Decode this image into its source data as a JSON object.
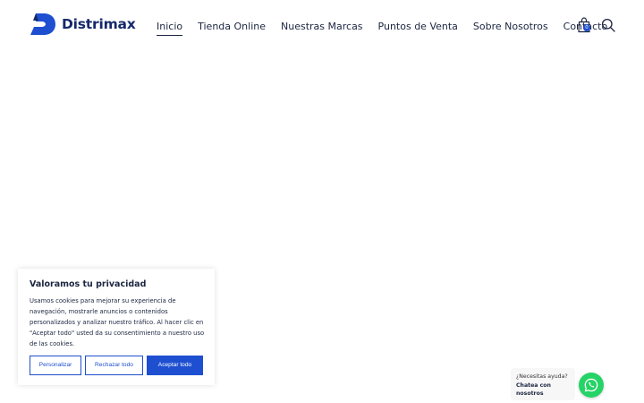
{
  "brand": {
    "name": "Distrimax",
    "color": "#15286a",
    "accent": "#1e4fd1"
  },
  "nav": {
    "items": [
      {
        "label": "Inicio",
        "active": true
      },
      {
        "label": "Tienda Online",
        "active": false
      },
      {
        "label": "Nuestras Marcas",
        "active": false
      },
      {
        "label": "Puntos de Venta",
        "active": false
      },
      {
        "label": "Sobre Nosotros",
        "active": false
      },
      {
        "label": "Contacto",
        "active": false
      }
    ]
  },
  "header_icons": {
    "cart_icon": "shopping-bag-icon",
    "cart_count": "0",
    "search_icon": "search-icon"
  },
  "cookie": {
    "title": "Valoramos tu privacidad",
    "body": "Usamos cookies para mejorar su experiencia de navegación, mostrarle anuncios o contenidos personalizados y analizar nuestro tráfico. Al hacer clic en \"Aceptar todo\" usted da su consentimiento a nuestro uso de las cookies.",
    "customize_label": "Personalizar",
    "reject_label": "Rechazar todo",
    "accept_label": "Aceptar todo"
  },
  "chat": {
    "question": "¿Necesitas ayuda?",
    "cta": "Chatea con nosotros",
    "icon": "whatsapp-icon",
    "color": "#25d366"
  }
}
